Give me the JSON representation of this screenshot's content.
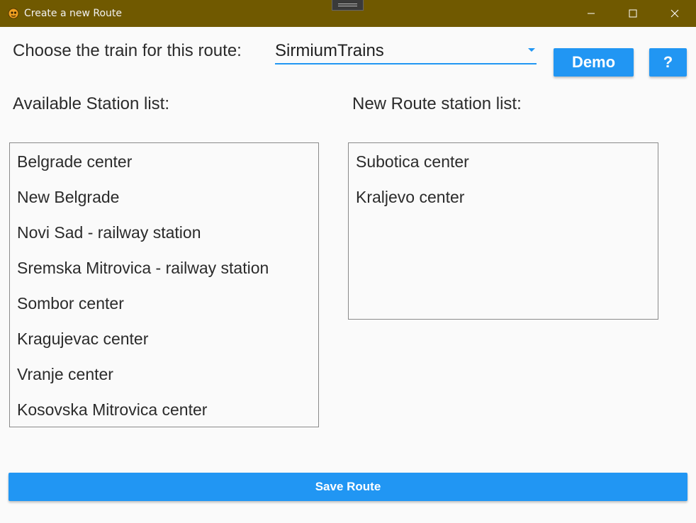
{
  "window": {
    "title": "Create a new Route",
    "titlebar_color": "#705900",
    "icon": "app-logo-icon"
  },
  "form": {
    "train_label": "Choose the train for this route:",
    "train_select_value": "SirmiumTrains",
    "demo_label": "Demo",
    "help_label": "?",
    "available_label": "Available Station list:",
    "route_label": "New Route station list:",
    "save_label": "Save Route"
  },
  "available_stations": [
    "Belgrade center",
    "New Belgrade",
    "Novi Sad - railway station",
    "Sremska Mitrovica - railway station",
    "Sombor center",
    "Kragujevac center",
    "Vranje center",
    "Kosovska Mitrovica center"
  ],
  "route_stations": [
    "Subotica center",
    "Kraljevo center"
  ],
  "colors": {
    "accent": "#2196f3",
    "text": "#2b2b2b"
  }
}
